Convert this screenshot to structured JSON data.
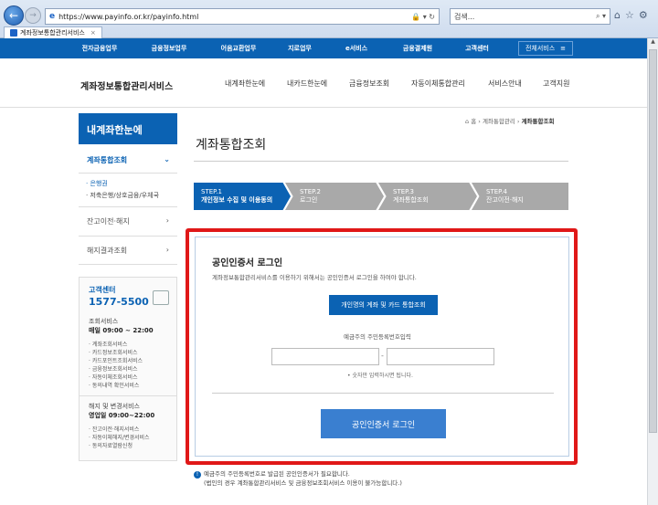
{
  "browser": {
    "url": "https://www.payinfo.or.kr/payinfo.html",
    "search_placeholder": "검색...",
    "tab_title": "계좌정보통합관리서비스",
    "addr_controls": "🔒 ▾ ↻",
    "search_controls": "⌕ ▾"
  },
  "gnb": {
    "items": [
      "전자금융업무",
      "금융정보업무",
      "어음교환업무",
      "지로업무",
      "e서비스",
      "금융결제원",
      "고객센터"
    ],
    "all_services": "전체서비스"
  },
  "header": {
    "site_title": "계좌정보통합관리서비스",
    "nav": [
      "내계좌한눈에",
      "내카드한눈에",
      "금융정보조회",
      "자동이체통합관리",
      "서비스안내",
      "고객지원"
    ]
  },
  "sidebar": {
    "head": "내계좌한눈에",
    "selected": "계좌통합조회",
    "sub_items": [
      "· 은행권",
      "· 저축은행/상호금융/우체국"
    ],
    "menus": [
      "잔고이전·해지",
      "해지결과조회"
    ],
    "cs": {
      "title": "고객센터",
      "phone": "1577-5500",
      "lookup_label": "조회서비스",
      "lookup_hours": "매일 09:00 ~ 22:00",
      "lookup_list": [
        "· 계좌조회서비스",
        "· 카드정보조회서비스",
        "· 카드포인트조회서비스",
        "· 금융정보조회서비스",
        "· 자동이체조회서비스",
        "· 동의내역 확인서비스"
      ],
      "change_label": "해지 및 변경서비스",
      "change_hours": "영업일 09:00~22:00",
      "change_list": [
        "· 잔고이전·해지서비스",
        "· 자동이체해지/변경서비스",
        "· 동의자료열람신청"
      ]
    }
  },
  "breadcrumb": {
    "home": "⌂ 홈",
    "mid": "계좌통합관리",
    "current": "계좌통합조회"
  },
  "page_title": "계좌통합조회",
  "steps": [
    {
      "num": "STEP.1",
      "label": "개인정보 수집 및 이용동의"
    },
    {
      "num": "STEP.2",
      "label": "로그인"
    },
    {
      "num": "STEP.3",
      "label": "계좌통합조회"
    },
    {
      "num": "STEP.4",
      "label": "잔고이전·해지"
    }
  ],
  "login": {
    "title": "공인인증서 로그인",
    "desc": "계좌정보통합관리서비스를 이용하기 위해서는 공인인증서 로그인을 하여야 합니다.",
    "integrated_button": "개인명의 계좌 및 카드 통합조회",
    "rrn_label": "예금주의 주민등록번호입력",
    "rrn_sep": "-",
    "rrn_hint": "• 숫자만 입력하시면 됩니다.",
    "login_button": "공인인증서 로그인"
  },
  "notice": {
    "line1": "예금주의 주민등록번호로 발급된 공인인증서가 필요합니다.",
    "line2": "(법인의 경우 계좌통합관리서비스 및 금융정보조회서비스 이용이 불가능합니다.)"
  },
  "colors": {
    "brand": "#0b62b3",
    "highlight_frame": "#e01818",
    "step_inactive": "#a9a9a9",
    "login_button": "#3a7fd0"
  }
}
